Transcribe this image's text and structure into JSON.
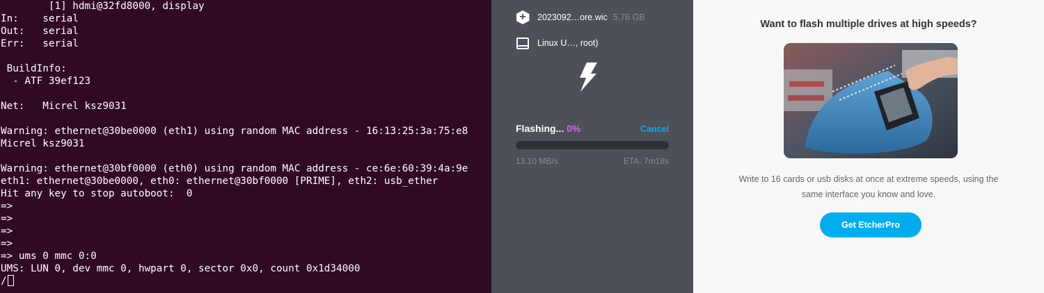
{
  "terminal": {
    "lines": [
      "        [1] hdmi@32fd8000, display",
      "In:    serial",
      "Out:   serial",
      "Err:   serial",
      "",
      " BuildInfo:",
      "  - ATF 39ef123",
      "",
      "Net:   Micrel ksz9031",
      "",
      "Warning: ethernet@30be0000 (eth1) using random MAC address - 16:13:25:3a:75:e8",
      "Micrel ksz9031",
      "",
      "Warning: ethernet@30bf0000 (eth0) using random MAC address - ce:6e:60:39:4a:9e",
      "eth1: ethernet@30be0000, eth0: ethernet@30bf0000 [PRIME], eth2: usb_ether",
      "Hit any key to stop autoboot:  0",
      "=>",
      "=>",
      "=>",
      "=>",
      "=> ums 0 mmc 0:0",
      "UMS: LUN 0, dev mmc 0, hwpart 0, sector 0x0, count 0x1d34000",
      "/"
    ]
  },
  "etcher": {
    "image_name": "2023092…ore.wic",
    "image_size": "5.76 GB",
    "target_name": "Linux U…, root)",
    "icons": {
      "image": "plus-hexagon-icon",
      "target": "drive-icon",
      "status": "lightning-icon"
    },
    "flashing_label": "Flashing...",
    "flashing_percent": "0%",
    "progress": 0,
    "cancel_label": "Cancel",
    "speed": "13.10 MB/s",
    "eta": "ETA: 7m18s",
    "colors": {
      "accent": "#da60f4",
      "link": "#00aeef",
      "panel": "#4d5057"
    }
  },
  "promo": {
    "title": "Want to flash multiple drives at high speeds?",
    "description": "Write to 16 cards or usb disks at once at extreme speeds, using the same interface you know and love.",
    "button_label": "Get EtcherPro"
  }
}
